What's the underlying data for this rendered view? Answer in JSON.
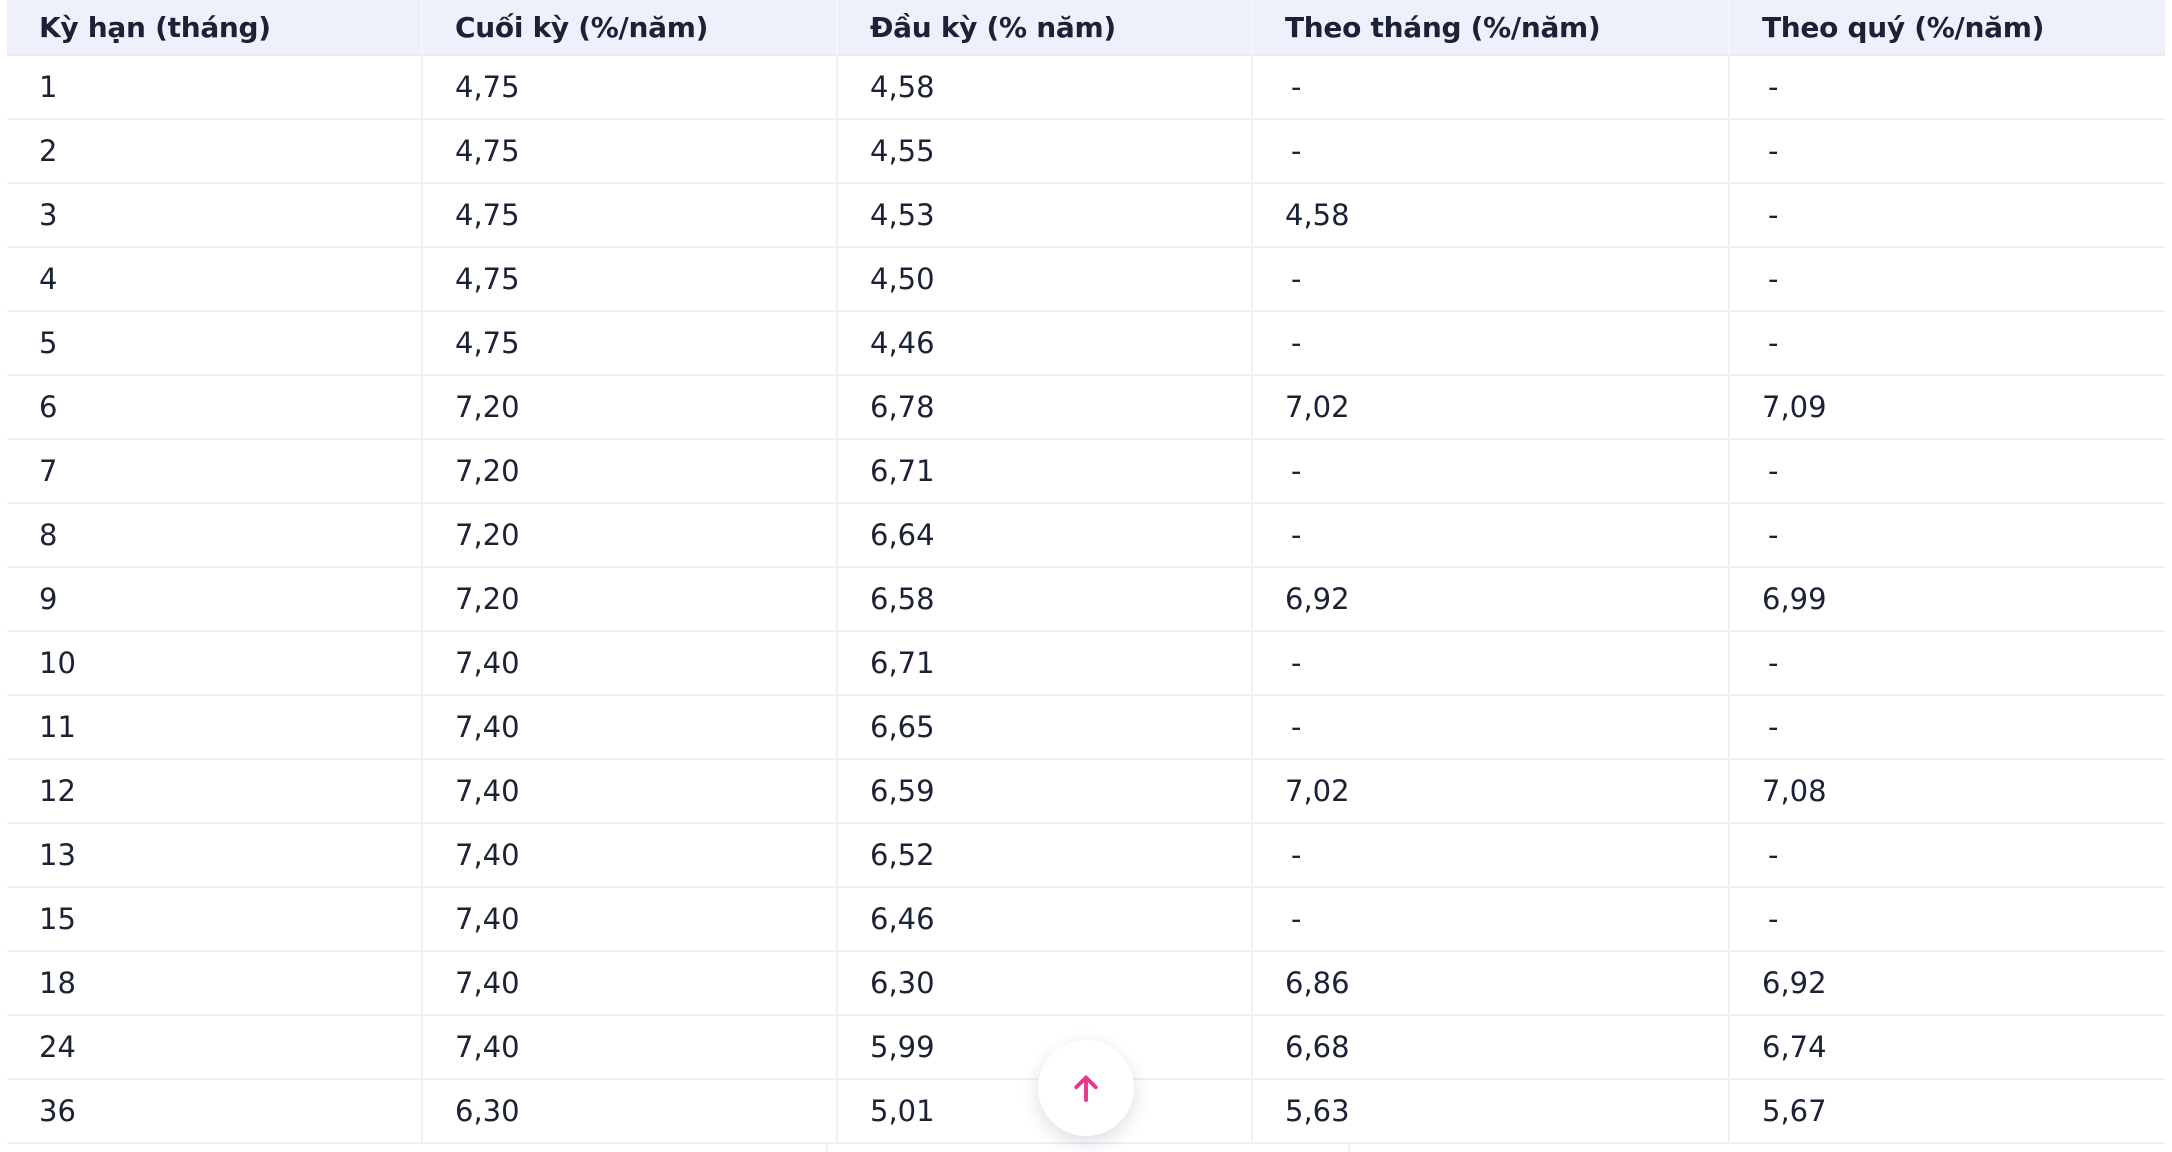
{
  "table": {
    "headers": [
      "Kỳ hạn (tháng)",
      "Cuối kỳ (%/năm)",
      "Đầu kỳ (% năm)",
      "Theo tháng (%/năm)",
      "Theo quý (%/năm)"
    ],
    "rows": [
      [
        "1",
        "4,75",
        "4,58",
        "-",
        "-"
      ],
      [
        "2",
        "4,75",
        "4,55",
        "-",
        "-"
      ],
      [
        "3",
        "4,75",
        "4,53",
        "4,58",
        "-"
      ],
      [
        "4",
        "4,75",
        "4,50",
        "-",
        "-"
      ],
      [
        "5",
        "4,75",
        "4,46",
        "-",
        "-"
      ],
      [
        "6",
        "7,20",
        "6,78",
        "7,02",
        "7,09"
      ],
      [
        "7",
        "7,20",
        "6,71",
        "-",
        "-"
      ],
      [
        "8",
        "7,20",
        "6,64",
        "-",
        "-"
      ],
      [
        "9",
        "7,20",
        "6,58",
        "6,92",
        "6,99"
      ],
      [
        "10",
        "7,40",
        "6,71",
        "-",
        "-"
      ],
      [
        "11",
        "7,40",
        "6,65",
        "-",
        "-"
      ],
      [
        "12",
        "7,40",
        "6,59",
        "7,02",
        "7,08"
      ],
      [
        "13",
        "7,40",
        "6,52",
        "-",
        "-"
      ],
      [
        "15",
        "7,40",
        "6,46",
        "-",
        "-"
      ],
      [
        "18",
        "7,40",
        "6,30",
        "6,86",
        "6,92"
      ],
      [
        "24",
        "7,40",
        "5,99",
        "6,68",
        "6,74"
      ],
      [
        "36",
        "6,30",
        "5,01",
        "5,63",
        "5,67"
      ]
    ]
  },
  "scroll_top_button": {
    "icon": "arrow-up-icon",
    "color": "#e8378a"
  },
  "colors": {
    "header_bg": "#eef0fc",
    "text": "#1b2236",
    "grid": "#eef0f5"
  }
}
